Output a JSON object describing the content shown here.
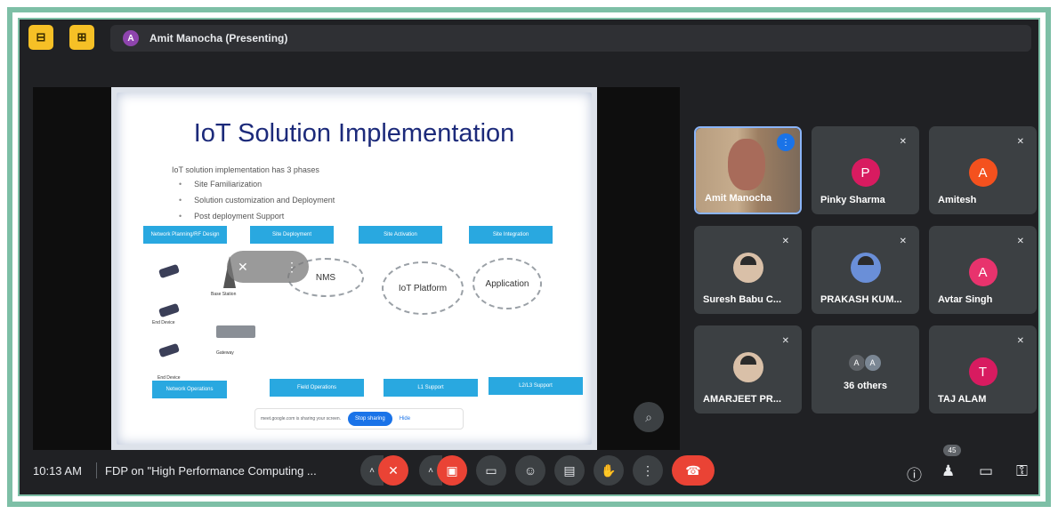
{
  "topbar": {
    "btn1_icon": "layout-icon",
    "btn2_icon": "pin-icon",
    "presenter_initial": "A",
    "presenter_label": "Amit Manocha (Presenting)"
  },
  "slide": {
    "title": "IoT Solution Implementation",
    "intro": "IoT solution implementation has 3 phases",
    "bullets": [
      "Site Familiarization",
      "Solution customization and Deployment",
      "Post deployment Support"
    ],
    "phases_top": [
      "Network Planning/RF Design",
      "Site Deployment",
      "Site Activation",
      "Site Integration"
    ],
    "phases_bottom": [
      "Network Operations",
      "Field Operations",
      "L1 Support",
      "L2/L3 Support"
    ],
    "clouds": [
      "NMS",
      "IoT Platform",
      "Application"
    ],
    "labels": {
      "base_station": "Base Station",
      "end_device_1": "End Device",
      "end_device_2": "End Device",
      "gateway": "Gateway"
    },
    "share_text": "meet.google.com is sharing your screen.",
    "stop_sharing": "Stop sharing",
    "hide": "Hide"
  },
  "tiles": {
    "amit": "Amit Manocha",
    "pinky": {
      "name": "Pinky Sharma",
      "initial": "P",
      "color": "#d81b60"
    },
    "amitesh": {
      "name": "Amitesh",
      "initial": "A",
      "color": "#f4511e"
    },
    "suresh": "Suresh Babu C...",
    "prakash": "PRAKASH KUM...",
    "avtar": {
      "name": "Avtar Singh",
      "initial": "A",
      "color": "#e8336d"
    },
    "amarjeet": "AMARJEET PR...",
    "others": {
      "label": "36 others",
      "a1": "A",
      "a2": "A"
    },
    "taj": {
      "name": "TAJ ALAM",
      "initial": "T",
      "color": "#d81b60"
    }
  },
  "bottombar": {
    "time": "10:13 AM",
    "meeting_title": "FDP on \"High Performance Computing ...",
    "participant_count": "45"
  }
}
